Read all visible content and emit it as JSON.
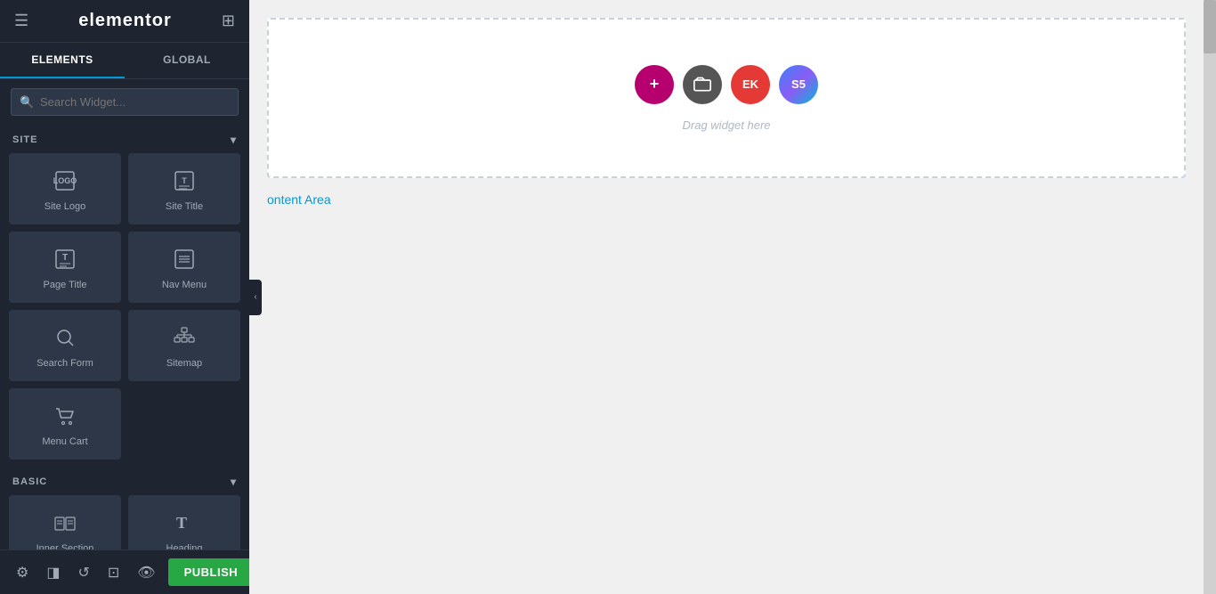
{
  "header": {
    "logo": "elementor",
    "hamburger_icon": "☰",
    "grid_icon": "⊞"
  },
  "tabs": [
    {
      "id": "elements",
      "label": "ELEMENTS",
      "active": true
    },
    {
      "id": "global",
      "label": "GLOBAL",
      "active": false
    }
  ],
  "search": {
    "placeholder": "Search Widget...",
    "value": ""
  },
  "site_section": {
    "label": "SITE",
    "widgets": [
      {
        "id": "site-logo",
        "label": "Site Logo"
      },
      {
        "id": "site-title",
        "label": "Site Title"
      },
      {
        "id": "page-title",
        "label": "Page Title"
      },
      {
        "id": "nav-menu",
        "label": "Nav Menu"
      },
      {
        "id": "search-form",
        "label": "Search Form"
      },
      {
        "id": "sitemap",
        "label": "Sitemap"
      },
      {
        "id": "menu-cart",
        "label": "Menu Cart"
      }
    ]
  },
  "basic_section": {
    "label": "BASIC",
    "widgets": [
      {
        "id": "inner-section",
        "label": "Inner Section"
      },
      {
        "id": "heading",
        "label": "Heading"
      }
    ]
  },
  "canvas": {
    "drop_text": "Drag widget here",
    "content_area_text": "ontent Area"
  },
  "bottom_bar": {
    "publish_label": "PUBLISH"
  },
  "toolbar_icons": [
    {
      "id": "settings",
      "icon": "⚙"
    },
    {
      "id": "layers",
      "icon": "◫"
    },
    {
      "id": "history",
      "icon": "↺"
    },
    {
      "id": "responsive",
      "icon": "⊡"
    },
    {
      "id": "eye",
      "icon": "👁"
    }
  ]
}
